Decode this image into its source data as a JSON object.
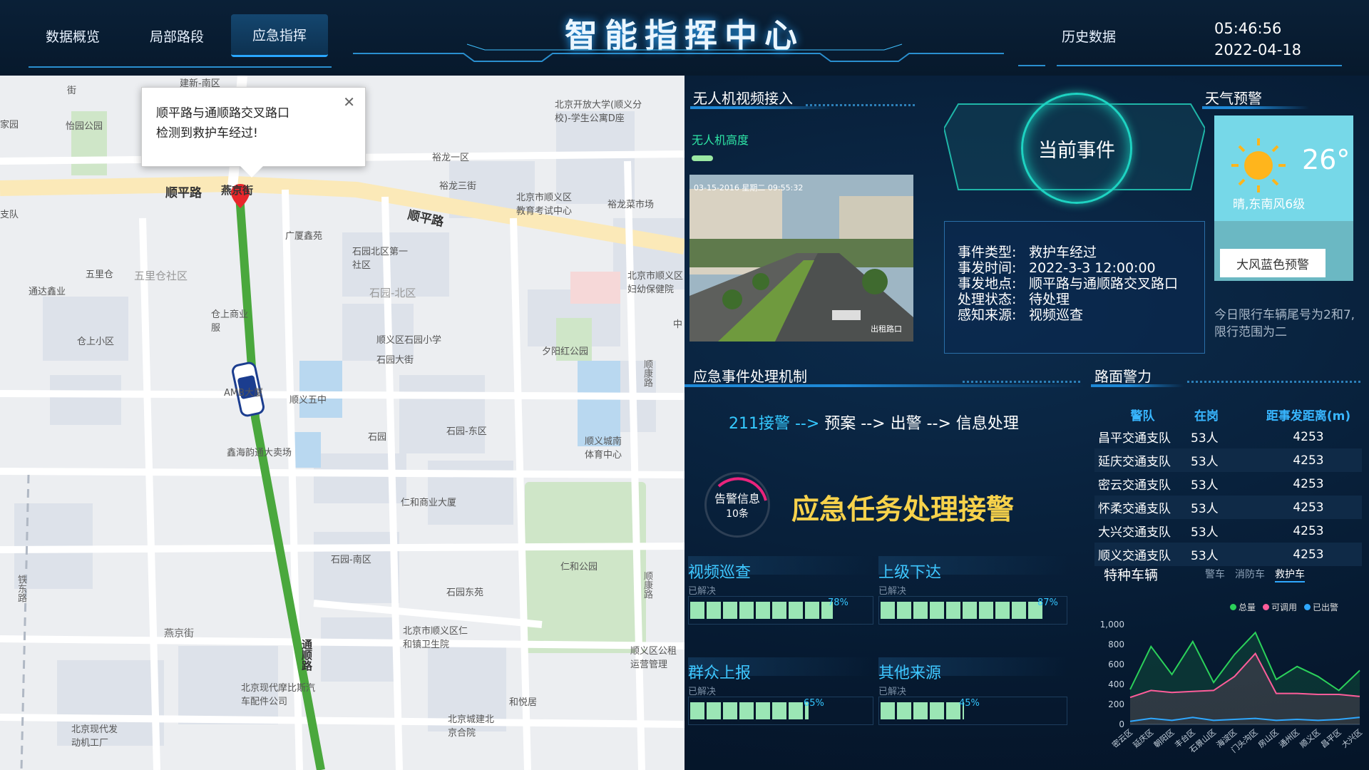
{
  "header": {
    "title": "智能指挥中心",
    "nav": [
      "数据概览",
      "局部路段",
      "应急指挥",
      "历史数据"
    ],
    "active_nav": "应急指挥",
    "time": "05:46:56",
    "date": "2022-04-18"
  },
  "map": {
    "popup_line1": "顺平路与通顺路交叉路口",
    "popup_line2": "检测到救护车经过!",
    "roads": [
      "顺平路",
      "燕京街",
      "顺平路",
      "通顺路",
      "顺康路",
      "铁东路",
      "燕京街",
      "顺康路"
    ],
    "pois": [
      "建新-南区",
      "怡园公园",
      "五里仓",
      "通达鑫业",
      "仓上小区",
      "五里仓社区",
      "仓上商业服",
      "AMB大厦",
      "广厦鑫苑",
      "石园北区第一社区",
      "石园-北区",
      "顺义区石园小学",
      "石园大街",
      "顺义五中",
      "石园",
      "石园-东区",
      "鑫海韵通大卖场",
      "仁和商业大厦",
      "石园-南区",
      "石园东苑",
      "北京市顺义区仁和镇卫生院",
      "北京现代摩比斯汽车配件公司",
      "北京现代发动机工厂",
      "北京城建北京合院",
      "和悦居",
      "裕龙一区",
      "裕龙三街",
      "北京市顺义区教育考试中心",
      "裕龙菜市场",
      "北京开放大学(顺义分校)-学生公寓D座",
      "北京市顺义区妇幼保健院",
      "夕阳红公园",
      "顺义城南体育中心",
      "仁和公园",
      "顺义区公租运营管理",
      "中",
      "家园",
      "支队",
      "街"
    ]
  },
  "drone": {
    "title": "无人机视频接入",
    "altitude_label": "无人机高度",
    "video_timestamp": "03-15-2016 星期二 09:55:32",
    "video_caption": "出租路口"
  },
  "event": {
    "title": "当前事件",
    "rows": [
      {
        "k": "事件类型:",
        "v": "救护车经过"
      },
      {
        "k": "事发时间:",
        "v": "2022-3-3 12:00:00"
      },
      {
        "k": "事发地点:",
        "v": "顺平路与通顺路交叉路口"
      },
      {
        "k": "处理状态:",
        "v": "待处理"
      },
      {
        "k": "感知来源:",
        "v": "视频巡查"
      }
    ]
  },
  "weather": {
    "title": "天气预警",
    "temp": "26°",
    "desc": "晴,东南风6级",
    "warning": "大风蓝色预警",
    "notice": "今日限行车辆尾号为2和7,限行范围为二"
  },
  "mechanism": {
    "title": "应急事件处理机制",
    "flow_a": "211接警 -->",
    "flow_b": " 预案 --> 出警 --> 信息处理",
    "gauge_label": "告警信息",
    "gauge_count": "10条",
    "big_title": "应急任务处理接警",
    "sources": [
      {
        "name": "视频巡查",
        "sub": "已解决",
        "pct": 78,
        "pct_label": "78%"
      },
      {
        "name": "上级下达",
        "sub": "已解决",
        "pct": 87,
        "pct_label": "87%"
      },
      {
        "name": "群众上报",
        "sub": "已解决",
        "pct": 65,
        "pct_label": "65%"
      },
      {
        "name": "其他来源",
        "sub": "已解决",
        "pct": 45,
        "pct_label": "45%"
      }
    ]
  },
  "police": {
    "title": "路面警力",
    "headers": [
      "警队",
      "在岗",
      "距事发距离(m)"
    ],
    "rows": [
      [
        "昌平交通支队",
        "53人",
        "4253"
      ],
      [
        "延庆交通支队",
        "53人",
        "4253"
      ],
      [
        "密云交通支队",
        "53人",
        "4253"
      ],
      [
        "怀柔交通支队",
        "53人",
        "4253"
      ],
      [
        "大兴交通支队",
        "53人",
        "4253"
      ],
      [
        "顺义交通支队",
        "53人",
        "4253"
      ]
    ]
  },
  "vehicles": {
    "title": "特种车辆",
    "tabs": [
      "警车",
      "消防车",
      "救护车"
    ],
    "active_tab": "救护车"
  },
  "chart_data": {
    "type": "line",
    "categories": [
      "密云区",
      "延庆区",
      "朝阳区",
      "丰台区",
      "石景山区",
      "海淀区",
      "门头沟区",
      "房山区",
      "通州区",
      "顺义区",
      "昌平区",
      "大兴区"
    ],
    "series": [
      {
        "name": "总量",
        "color": "#2bd15a",
        "values": [
          350,
          780,
          500,
          830,
          420,
          700,
          920,
          450,
          580,
          480,
          340,
          540
        ]
      },
      {
        "name": "可调用",
        "color": "#ff5d9a",
        "values": [
          270,
          340,
          320,
          330,
          340,
          480,
          710,
          310,
          310,
          300,
          300,
          280
        ]
      },
      {
        "name": "已出警",
        "color": "#2fa8ff",
        "values": [
          30,
          60,
          40,
          70,
          40,
          50,
          60,
          40,
          50,
          40,
          50,
          70
        ]
      }
    ],
    "ylim": [
      0,
      1000
    ],
    "yticks": [
      "1,000",
      "800",
      "600",
      "400",
      "200",
      "0"
    ],
    "legend": "top-right"
  }
}
